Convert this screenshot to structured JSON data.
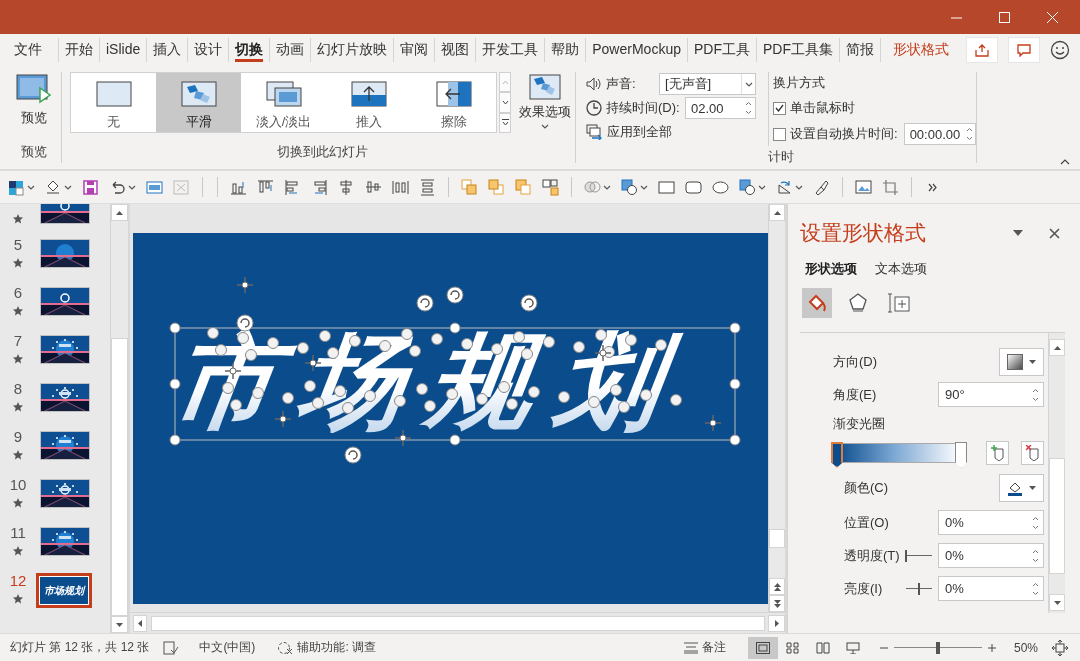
{
  "tabs": [
    {
      "label": "文件",
      "selected": false,
      "contextual": false
    },
    {
      "label": "开始",
      "selected": false,
      "contextual": false
    },
    {
      "label": "iSlide",
      "selected": false,
      "contextual": false
    },
    {
      "label": "插入",
      "selected": false,
      "contextual": false
    },
    {
      "label": "设计",
      "selected": false,
      "contextual": false
    },
    {
      "label": "切换",
      "selected": true,
      "contextual": false
    },
    {
      "label": "动画",
      "selected": false,
      "contextual": false
    },
    {
      "label": "幻灯片放映",
      "selected": false,
      "contextual": false
    },
    {
      "label": "审阅",
      "selected": false,
      "contextual": false
    },
    {
      "label": "视图",
      "selected": false,
      "contextual": false
    },
    {
      "label": "开发工具",
      "selected": false,
      "contextual": false
    },
    {
      "label": "帮助",
      "selected": false,
      "contextual": false
    },
    {
      "label": "PowerMockup",
      "selected": false,
      "contextual": false
    },
    {
      "label": "PDF工具",
      "selected": false,
      "contextual": false
    },
    {
      "label": "PDF工具集",
      "selected": false,
      "contextual": false
    },
    {
      "label": "简报",
      "selected": false,
      "contextual": false
    },
    {
      "label": "形状格式",
      "selected": false,
      "contextual": true
    }
  ],
  "ribbon": {
    "preview": {
      "button": "预览",
      "group_label": "预览"
    },
    "transitions": {
      "items": [
        {
          "label": "无",
          "selected": false
        },
        {
          "label": "平滑",
          "selected": true
        },
        {
          "label": "淡入/淡出",
          "selected": false
        },
        {
          "label": "推入",
          "selected": false
        },
        {
          "label": "擦除",
          "selected": false
        }
      ],
      "effect_options": "效果选项",
      "group_label": "切换到此幻灯片"
    },
    "timing": {
      "sound_label": "声音:",
      "sound_value": "[无声音]",
      "duration_label": "持续时间(D):",
      "duration_value": "02.00",
      "apply_all": "应用到全部",
      "advance_label": "换片方式",
      "on_click": {
        "label": "单击鼠标时",
        "checked": true
      },
      "after": {
        "label": "设置自动换片时间:",
        "checked": false,
        "value": "00:00.00"
      },
      "group_label": "计时"
    }
  },
  "slides": [
    {
      "selected": false
    },
    {
      "number": "5",
      "selected": false
    },
    {
      "number": "6",
      "selected": false
    },
    {
      "number": "7",
      "selected": false
    },
    {
      "number": "8",
      "selected": false
    },
    {
      "number": "9",
      "selected": false
    },
    {
      "number": "10",
      "selected": false
    },
    {
      "number": "11",
      "selected": false
    },
    {
      "number": "12",
      "selected": true,
      "thumb_text": "市场规划"
    }
  ],
  "slide": {
    "title": "市场规划"
  },
  "format_pane": {
    "title": "设置形状格式",
    "tabs": [
      {
        "label": "形状选项",
        "selected": true
      },
      {
        "label": "文本选项",
        "selected": false
      }
    ],
    "icon_tabs": [
      {
        "selected": true
      },
      {
        "selected": false
      },
      {
        "selected": false
      }
    ],
    "direction_label": "方向(D)",
    "angle_label": "角度(E)",
    "angle_value": "90°",
    "stops_label": "渐变光圈",
    "stops": [
      {
        "level": 0,
        "selected": true
      },
      {
        "level": 1,
        "selected": false
      }
    ],
    "color_label": "颜色(C)",
    "position_label": "位置(O)",
    "position_value": "0%",
    "transparency": {
      "label": "透明度(T)",
      "level": 0,
      "value": "0%"
    },
    "brightness": {
      "label": "亮度(I)",
      "level": 0.5,
      "value": "0%"
    }
  },
  "status": {
    "slide_info": "幻灯片 第 12 张，共 12 张",
    "language": "中文(中国)",
    "accessibility": "辅助功能: 调查",
    "notes": "备注",
    "views": [
      {
        "selected": true
      },
      {
        "selected": false
      },
      {
        "selected": false
      },
      {
        "selected": false
      }
    ],
    "zoom_slider": {
      "level": 0.5
    },
    "zoom": "50%"
  }
}
